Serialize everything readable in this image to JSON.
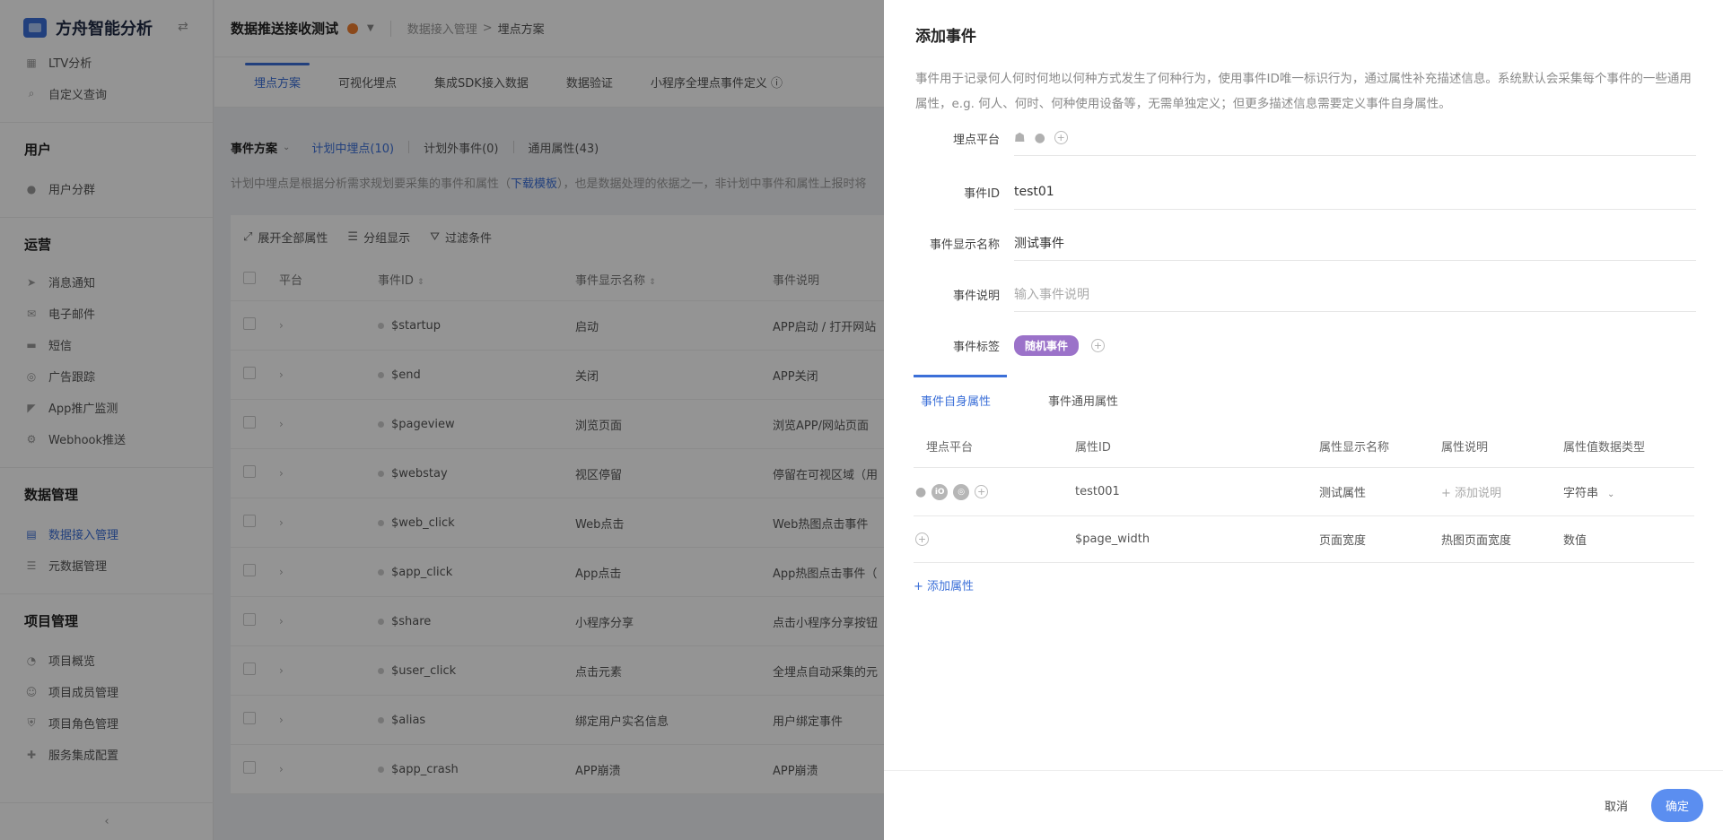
{
  "sidebar": {
    "app_title": "方舟智能分析",
    "items_top": [
      {
        "icon": "chart-icon",
        "label": "LTV分析"
      },
      {
        "icon": "search-icon",
        "label": "自定义查询"
      }
    ],
    "group_user": "用户",
    "items_user": [
      {
        "icon": "users-icon",
        "label": "用户分群"
      }
    ],
    "group_ops": "运营",
    "items_ops": [
      {
        "icon": "send-icon",
        "label": "消息通知"
      },
      {
        "icon": "mail-icon",
        "label": "电子邮件"
      },
      {
        "icon": "sms-icon",
        "label": "短信"
      },
      {
        "icon": "target-icon",
        "label": "广告跟踪"
      },
      {
        "icon": "megaphone-icon",
        "label": "App推广监测"
      },
      {
        "icon": "webhook-icon",
        "label": "Webhook推送"
      }
    ],
    "group_data": "数据管理",
    "items_data": [
      {
        "icon": "database-icon",
        "label": "数据接入管理",
        "active": true
      },
      {
        "icon": "list-icon",
        "label": "元数据管理"
      }
    ],
    "group_project": "项目管理",
    "items_project": [
      {
        "icon": "overview-icon",
        "label": "项目概览"
      },
      {
        "icon": "member-icon",
        "label": "项目成员管理"
      },
      {
        "icon": "role-icon",
        "label": "项目角色管理"
      },
      {
        "icon": "puzzle-icon",
        "label": "服务集成配置"
      }
    ],
    "collapse_icon": "chevron-left-icon"
  },
  "header": {
    "project_name": "数据推送接收测试",
    "breadcrumb_parent": "数据接入管理",
    "breadcrumb_sep": ">",
    "breadcrumb_current": "埋点方案"
  },
  "tabs": [
    "埋点方案",
    "可视化埋点",
    "集成SDK接入数据",
    "数据验证",
    "小程序全埋点事件定义 ⓘ"
  ],
  "scheme": {
    "label": "事件方案",
    "tabs": [
      "计划中埋点(10)",
      "计划外事件(0)",
      "通用属性(43)"
    ],
    "hint_prefix": "计划中埋点是根据分析需求规划要采集的事件和属性（",
    "hint_link": "下载模板",
    "hint_suffix": "），也是数据处理的依据之一，非计划中事件和属性上报时将"
  },
  "toolbar": {
    "expand": "展开全部属性",
    "group": "分组显示",
    "filter": "过滤条件"
  },
  "table": {
    "headers": {
      "platform": "平台",
      "event_id": "事件ID",
      "display_name": "事件显示名称",
      "desc": "事件说明"
    },
    "rows": [
      {
        "id": "$startup",
        "name": "启动",
        "desc": "APP启动 / 打开网站"
      },
      {
        "id": "$end",
        "name": "关闭",
        "desc": "APP关闭"
      },
      {
        "id": "$pageview",
        "name": "浏览页面",
        "desc": "浏览APP/网站页面"
      },
      {
        "id": "$webstay",
        "name": "视区停留",
        "desc": "停留在可视区域（用"
      },
      {
        "id": "$web_click",
        "name": "Web点击",
        "desc": "Web热图点击事件"
      },
      {
        "id": "$app_click",
        "name": "App点击",
        "desc": "App热图点击事件（"
      },
      {
        "id": "$share",
        "name": "小程序分享",
        "desc": "点击小程序分享按钮"
      },
      {
        "id": "$user_click",
        "name": "点击元素",
        "desc": "全埋点自动采集的元"
      },
      {
        "id": "$alias",
        "name": "绑定用户实名信息",
        "desc": "用户绑定事件"
      },
      {
        "id": "$app_crash",
        "name": "APP崩溃",
        "desc": "APP崩溃"
      }
    ]
  },
  "drawer": {
    "title": "添加事件",
    "description": "事件用于记录何人何时何地以何种方式发生了何种行为，使用事件ID唯一标识行为，通过属性补充描述信息。系统默认会采集每个事件的一些通用属性，e.g. 何人、何时、何种使用设备等，无需单独定义；但更多描述信息需要定义事件自身属性。",
    "labels": {
      "platform": "埋点平台",
      "event_id": "事件ID",
      "display_name": "事件显示名称",
      "desc": "事件说明",
      "tags": "事件标签"
    },
    "values": {
      "event_id": "test01",
      "display_name": "测试事件",
      "desc_placeholder": "输入事件说明"
    },
    "tag": "随机事件",
    "sub_tabs": [
      "事件自身属性",
      "事件通用属性"
    ],
    "prop_headers": {
      "platform": "埋点平台",
      "id": "属性ID",
      "name": "属性显示名称",
      "desc": "属性说明",
      "type": "属性值数据类型"
    },
    "props": [
      {
        "id": "test001",
        "name": "测试属性",
        "desc": "+ 添加说明",
        "type": "字符串"
      },
      {
        "id": "$page_width",
        "name": "页面宽度",
        "desc": "热图页面宽度",
        "type": "数值"
      }
    ],
    "add_prop": "+ 添加属性",
    "cancel": "取消",
    "ok": "确定"
  }
}
